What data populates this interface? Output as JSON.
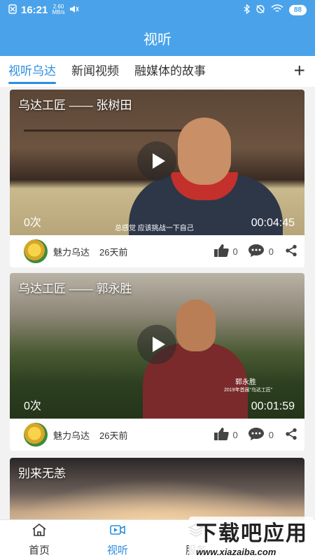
{
  "status": {
    "time": "16:21",
    "speed_value": "2.60",
    "speed_unit": "MB/s",
    "battery": "88"
  },
  "header": {
    "title": "视听"
  },
  "tabs": [
    {
      "label": "视听乌达",
      "active": true
    },
    {
      "label": "新闻视频"
    },
    {
      "label": "融媒体的故事"
    }
  ],
  "add_label": "+",
  "videos": [
    {
      "title": "乌达工匠 —— 张树田",
      "views": "0次",
      "duration": "00:04:45",
      "subtitle": "总感觉 应该挑战一下自己",
      "publisher": "魅力乌达",
      "time_ago": "26天前",
      "likes": "0",
      "comments": "0"
    },
    {
      "title": "乌达工匠 —— 郭永胜",
      "views": "0次",
      "duration": "00:01:59",
      "caption_name": "郭永胜",
      "caption_sub": "2019年首届“乌达工匠”",
      "publisher": "魅力乌达",
      "time_ago": "26天前",
      "likes": "0",
      "comments": "0"
    },
    {
      "title": "别来无恙"
    }
  ],
  "tabbar": [
    {
      "label": "首页",
      "icon": "home-icon"
    },
    {
      "label": "视听",
      "icon": "video-icon",
      "active": true
    },
    {
      "label": "服务",
      "icon": "layers-icon"
    }
  ],
  "watermark": {
    "main": "下载吧应用",
    "sub": "www.xiazaiba.com"
  },
  "colors": {
    "primary": "#4aa3ea",
    "accent": "#2a8de0"
  }
}
